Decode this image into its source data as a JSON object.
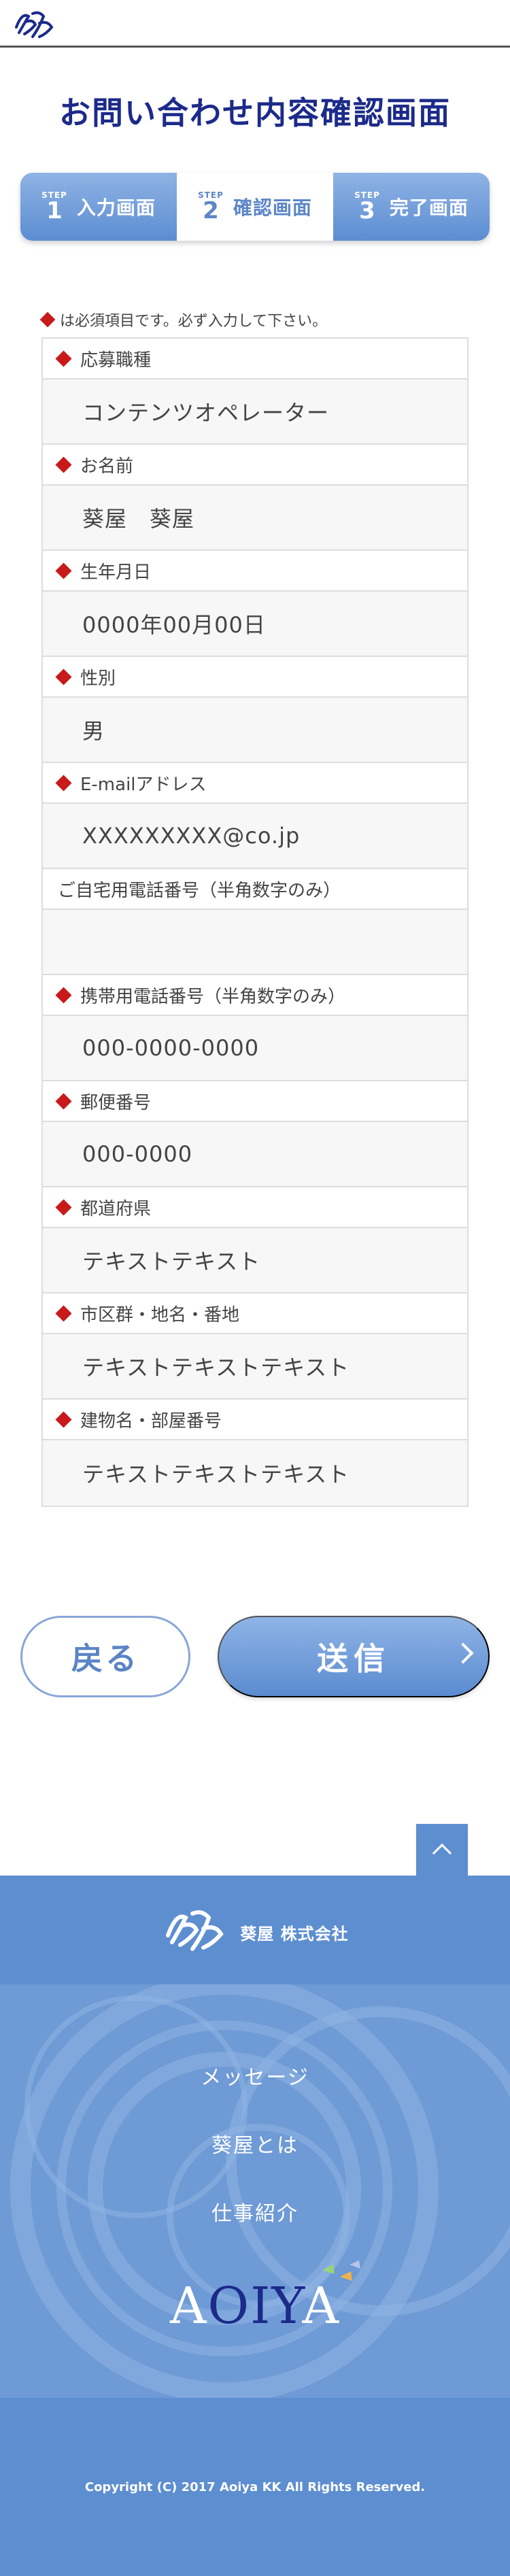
{
  "header": {
    "logo_alt": "葵屋"
  },
  "page_title": "お問い合わせ内容確認画面",
  "steps": [
    {
      "label": "STEP",
      "num": "1",
      "text": "入力画面",
      "active": false
    },
    {
      "label": "STEP",
      "num": "2",
      "text": "確認画面",
      "active": true
    },
    {
      "label": "STEP",
      "num": "3",
      "text": "完了画面",
      "active": false
    }
  ],
  "note": "は必須項目です。必ず入力して下さい。",
  "fields": [
    {
      "label": "応募職種",
      "required": true,
      "value": "コンテンツオペレーター"
    },
    {
      "label": "お名前",
      "required": true,
      "value": "葵屋　葵屋"
    },
    {
      "label": "生年月日",
      "required": true,
      "value": "0000年00月00日"
    },
    {
      "label": "性別",
      "required": true,
      "value": "男"
    },
    {
      "label": "E-mailアドレス",
      "required": true,
      "value": "XXXXXXXXX@co.jp"
    },
    {
      "label": "ご自宅用電話番号（半角数字のみ）",
      "required": false,
      "value": ""
    },
    {
      "label": "携帯用電話番号（半角数字のみ）",
      "required": true,
      "value": "000-0000-0000"
    },
    {
      "label": "郵便番号",
      "required": true,
      "value": "000-0000"
    },
    {
      "label": "都道府県",
      "required": true,
      "value": "テキストテキスト"
    },
    {
      "label": "市区群・地名・番地",
      "required": true,
      "value": "テキストテキストテキスト"
    },
    {
      "label": "建物名・部屋番号",
      "required": true,
      "value": "テキストテキストテキスト"
    }
  ],
  "buttons": {
    "back": "戻る",
    "send": "送信"
  },
  "footer": {
    "company": "葵屋 株式会社",
    "nav": [
      "メッセージ",
      "葵屋とは",
      "仕事紹介"
    ],
    "brand": "AOIYA",
    "copyright": "Copyright (C) 2017 Aoiya KK All Rights Reserved."
  },
  "colors": {
    "navy": "#1c2a8a",
    "blue": "#5d8ed0",
    "required": "#c81a1a"
  }
}
